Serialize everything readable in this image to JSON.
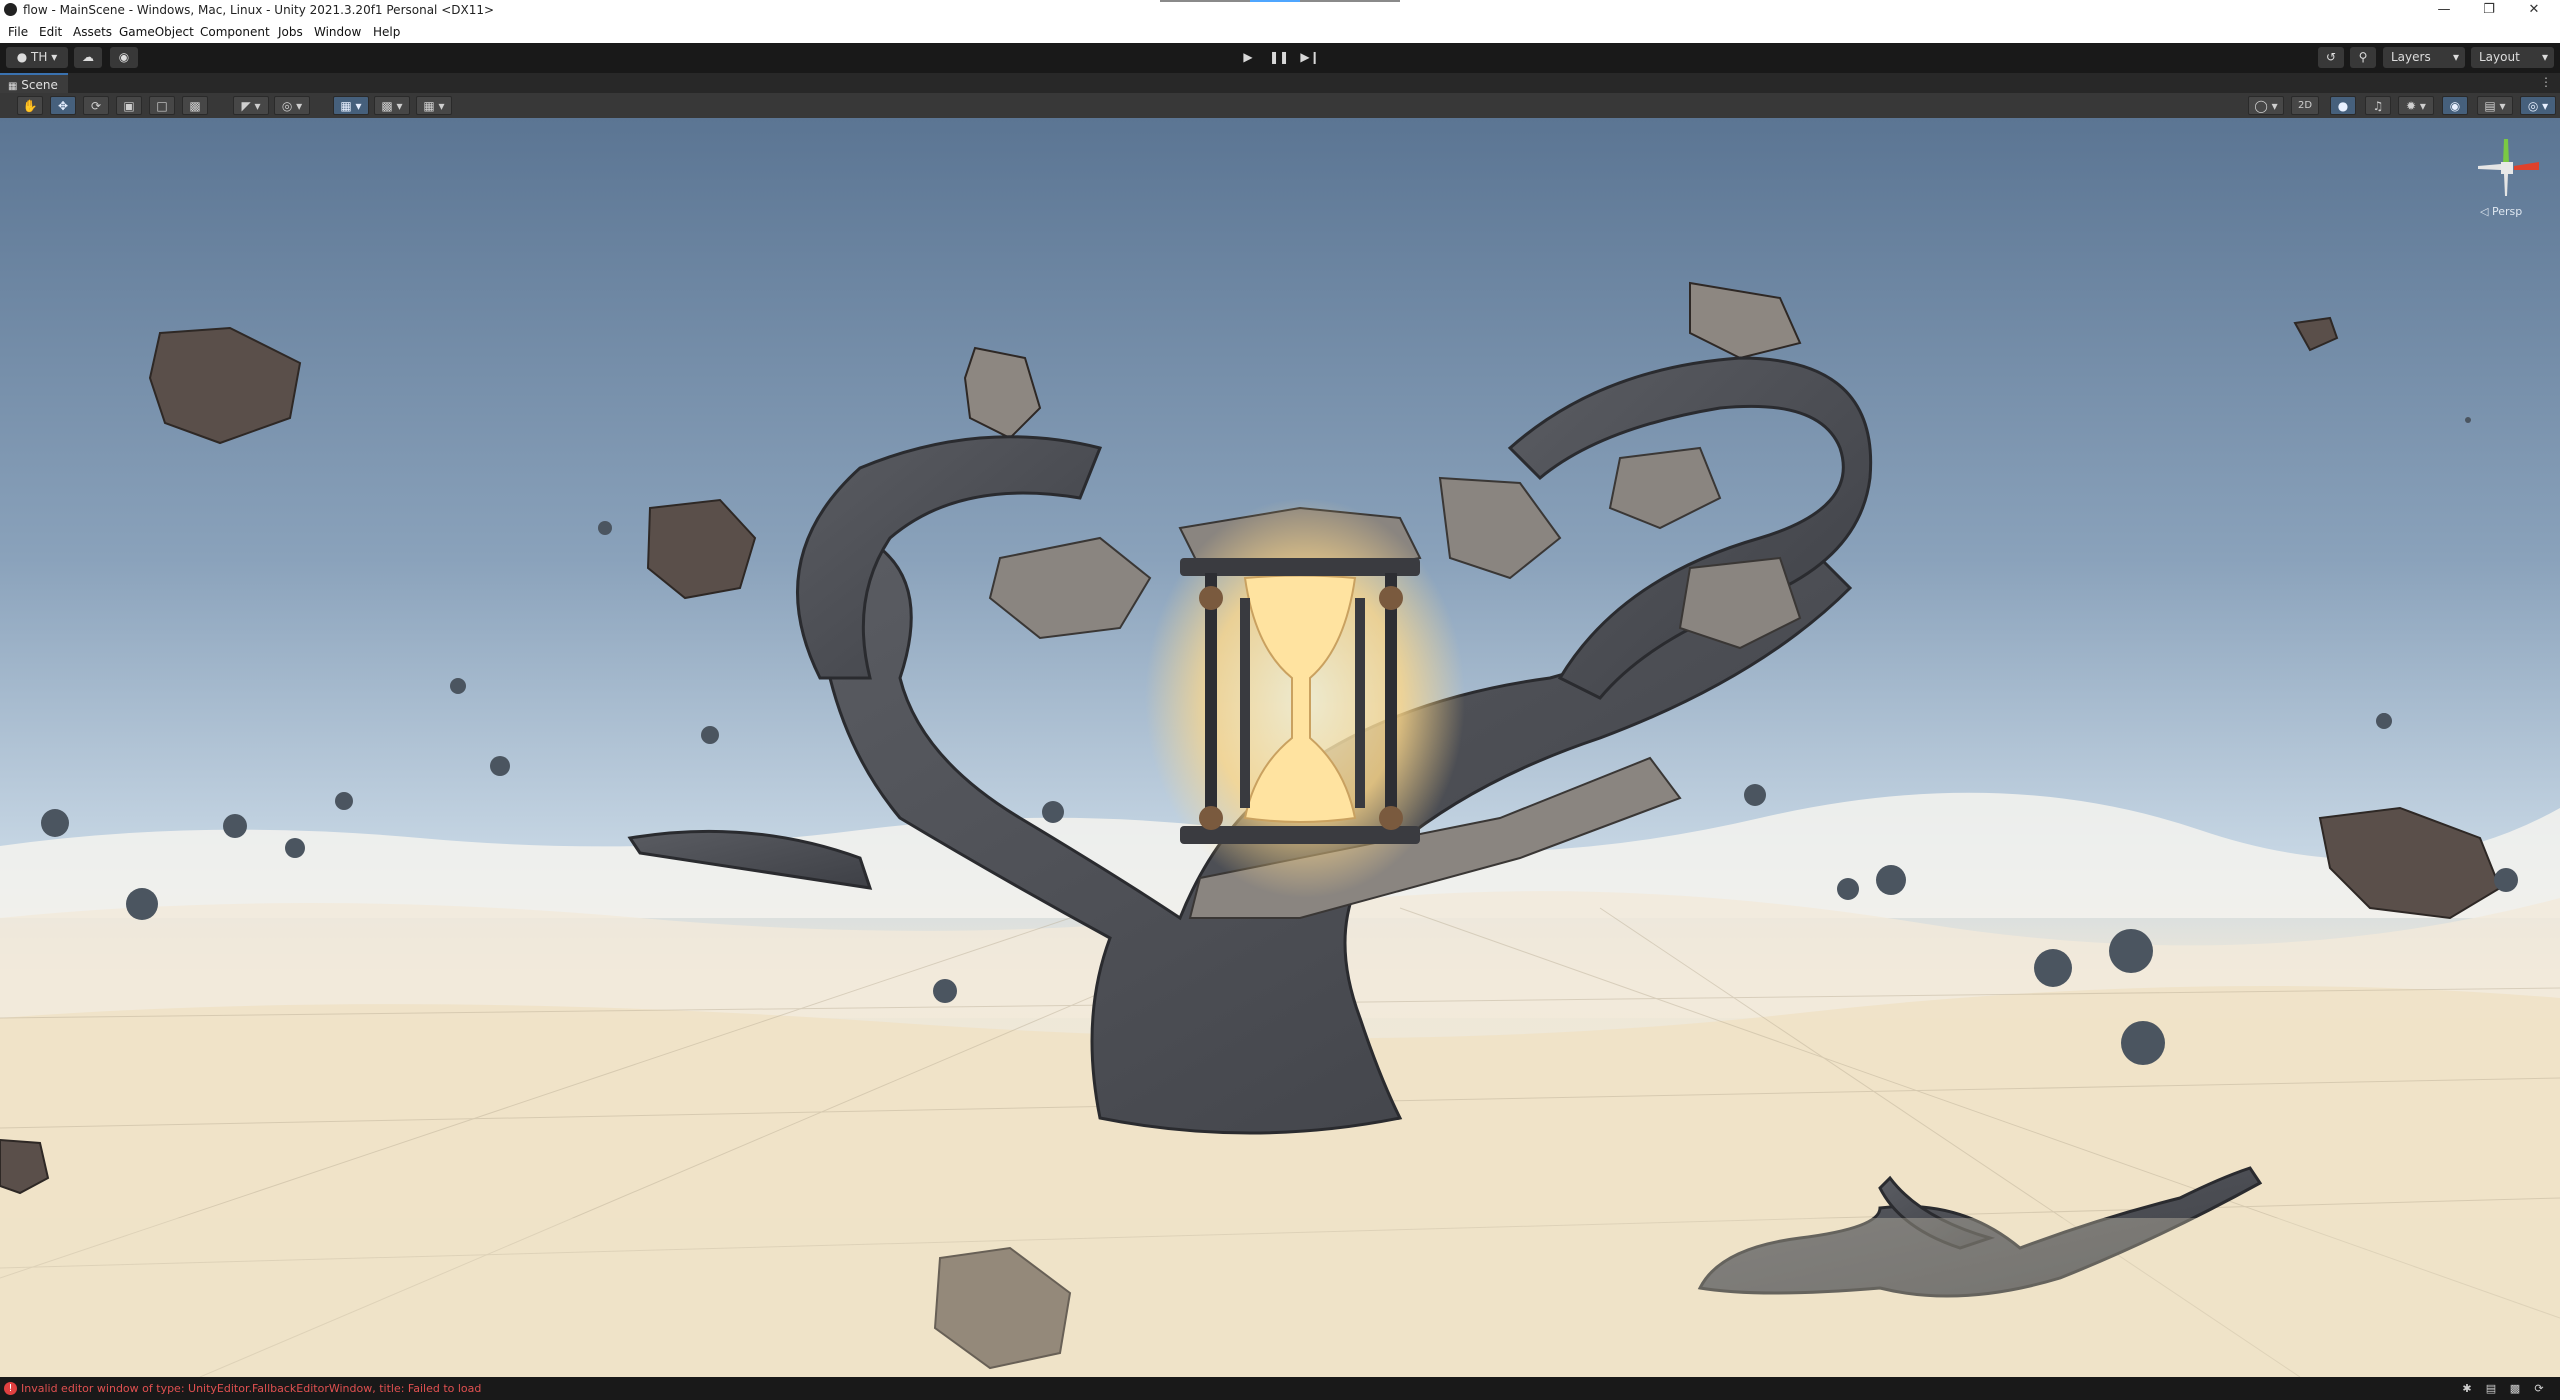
{
  "window": {
    "title": "flow - MainScene - Windows, Mac, Linux - Unity 2021.3.20f1 Personal <DX11>"
  },
  "menu": [
    "File",
    "Edit",
    "Assets",
    "GameObject",
    "Component",
    "Jobs",
    "Window",
    "Help"
  ],
  "toolbar": {
    "account_label": "TH",
    "layers_label": "Layers",
    "layout_label": "Layout"
  },
  "scene_tab": {
    "label": "Scene"
  },
  "scene_toolbar": {
    "mode_2d_label": "2D"
  },
  "gizmo": {
    "projection_label": "◁ Persp"
  },
  "status": {
    "error_message": "Invalid editor window of type: UnityEditor.FallbackEditorWindow, title: Failed to load"
  },
  "colors": {
    "error": "#e05050",
    "active_tool": "#46607c",
    "sky_top": "#5f7895",
    "horizon": "#c8d8e6",
    "sand": "#f0dfc0"
  }
}
